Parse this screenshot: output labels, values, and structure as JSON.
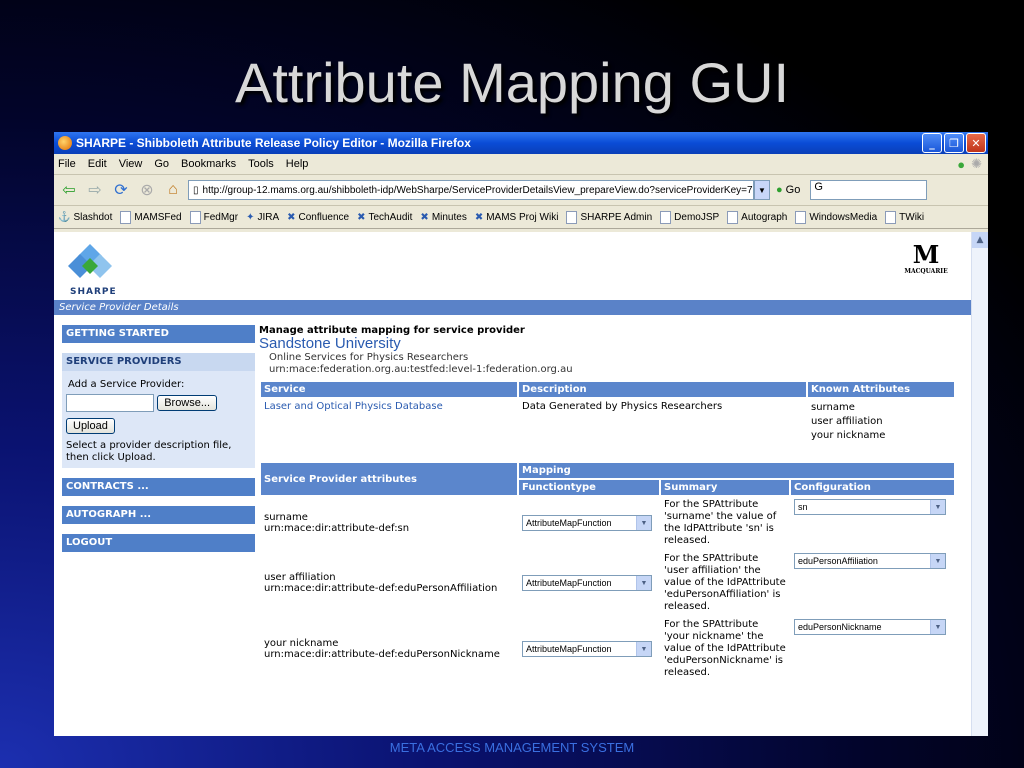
{
  "slide": {
    "title": "Attribute Mapping GUI",
    "footer": "META ACCESS MANAGEMENT SYSTEM"
  },
  "window": {
    "title": "SHARPE - Shibboleth Attribute Release Policy Editor - Mozilla Firefox",
    "menu": [
      "File",
      "Edit",
      "View",
      "Go",
      "Bookmarks",
      "Tools",
      "Help"
    ],
    "url": "http://group-12.mams.org.au/shibboleth-idp/WebSharpe/ServiceProviderDetailsView_prepareView.do?serviceProviderKey=7",
    "go_label": "Go",
    "search_value": "G"
  },
  "bookmarks": [
    "Slashdot",
    "MAMSFed",
    "FedMgr",
    "JIRA",
    "Confluence",
    "TechAudit",
    "Minutes",
    "MAMS Proj Wiki",
    "SHARPE Admin",
    "DemoJSP",
    "Autograph",
    "WindowsMedia",
    "TWiki"
  ],
  "page": {
    "logo_text": "SHARPE",
    "macquarie": "MACQUARIE",
    "section": "Service Provider Details",
    "nav": {
      "getting_started": "GETTING STARTED",
      "service_providers": "SERVICE PROVIDERS",
      "add_label": "Add a Service Provider:",
      "browse": "Browse...",
      "upload": "Upload",
      "help": "Select a provider description file, then click Upload.",
      "contracts": "CONTRACTS ...",
      "autograph": "AUTOGRAPH ...",
      "logout": "LOGOUT"
    },
    "header": {
      "manage": "Manage attribute mapping for service provider",
      "sp_name": "Sandstone University",
      "sp_desc": "Online Services for Physics Researchers",
      "sp_urn": "urn:mace:federation.org.au:testfed:level-1:federation.org.au"
    },
    "service_table": {
      "headers": [
        "Service",
        "Description",
        "Known Attributes"
      ],
      "service": "Laser and Optical Physics Database",
      "description": "Data Generated by Physics Researchers",
      "attributes": [
        "surname",
        "user affiliation",
        "your nickname"
      ]
    },
    "mapping_table": {
      "sp_attr_header": "Service Provider attributes",
      "mapping_header": "Mapping",
      "sub_headers": [
        "Functiontype",
        "Summary",
        "Configuration"
      ],
      "rows": [
        {
          "name": "surname",
          "urn": "urn:mace:dir:attribute-def:sn",
          "function": "AttributeMapFunction",
          "summary": "For the SPAttribute 'surname' the value of the IdPAttribute 'sn' is released.",
          "config": "sn"
        },
        {
          "name": "user affiliation",
          "urn": "urn:mace:dir:attribute-def:eduPersonAffiliation",
          "function": "AttributeMapFunction",
          "summary": "For the SPAttribute 'user affiliation' the value of the IdPAttribute 'eduPersonAffiliation' is released.",
          "config": "eduPersonAffiliation"
        },
        {
          "name": "your nickname",
          "urn": "urn:mace:dir:attribute-def:eduPersonNickname",
          "function": "AttributeMapFunction",
          "summary": "For the SPAttribute 'your nickname' the value of the IdPAttribute 'eduPersonNickname' is released.",
          "config": "eduPersonNickname"
        }
      ]
    }
  }
}
